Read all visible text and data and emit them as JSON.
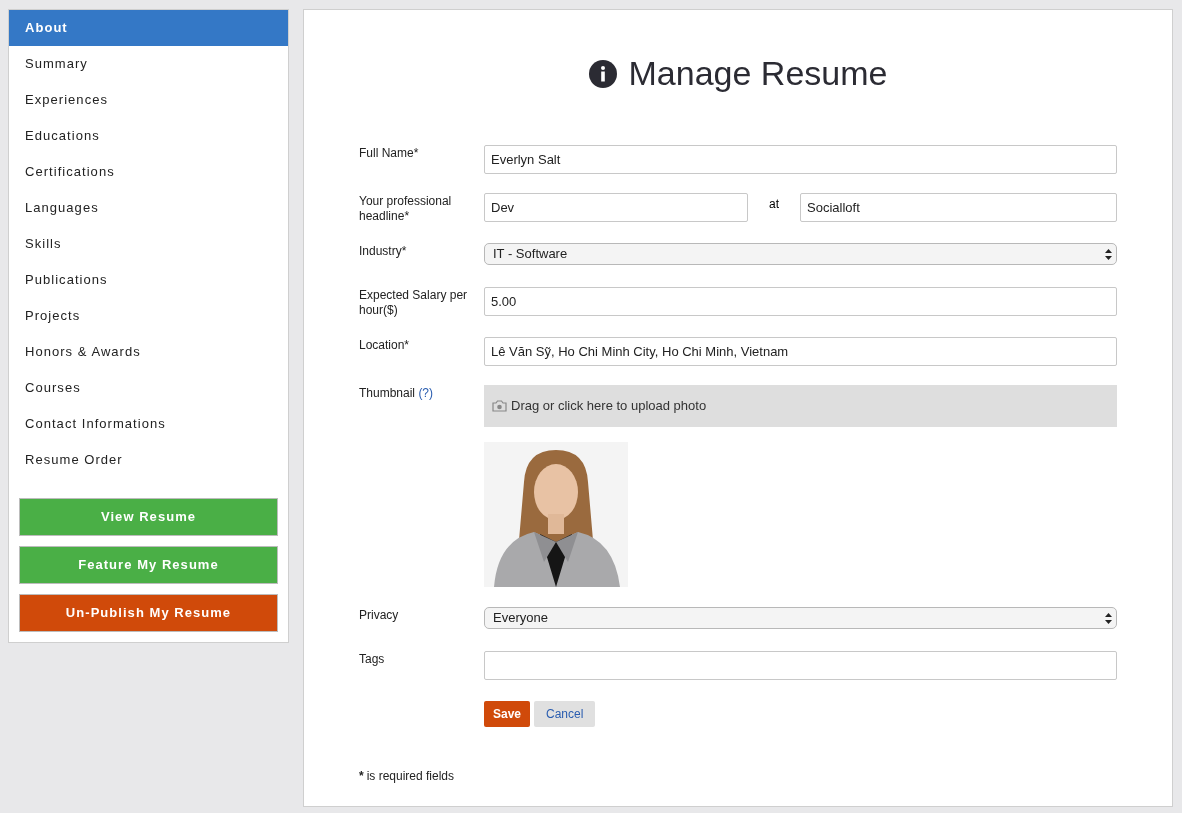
{
  "sidebar": {
    "items": [
      {
        "label": "About",
        "selected": true
      },
      {
        "label": "Summary",
        "selected": false
      },
      {
        "label": "Experiences",
        "selected": false
      },
      {
        "label": "Educations",
        "selected": false
      },
      {
        "label": "Certifications",
        "selected": false
      },
      {
        "label": "Languages",
        "selected": false
      },
      {
        "label": "Skills",
        "selected": false
      },
      {
        "label": "Publications",
        "selected": false
      },
      {
        "label": "Projects",
        "selected": false
      },
      {
        "label": "Honors & Awards",
        "selected": false
      },
      {
        "label": "Courses",
        "selected": false
      },
      {
        "label": "Contact Informations",
        "selected": false
      },
      {
        "label": "Resume Order",
        "selected": false
      }
    ],
    "buttons": [
      {
        "label": "View Resume",
        "color": "#4aaf46"
      },
      {
        "label": "Feature My Resume",
        "color": "#4aaf46"
      },
      {
        "label": "Un-Publish My Resume",
        "color": "#d04a0a"
      }
    ]
  },
  "title": "Manage Resume",
  "fields": [
    {
      "kind": "text",
      "label": "Full Name*",
      "value": "Everlyn Salt"
    },
    {
      "kind": "pair",
      "label": "Your professional headline*",
      "value": "Dev",
      "joiner": "at",
      "value2": "Socialloft"
    },
    {
      "kind": "select",
      "label": "Industry*",
      "value": "IT - Software"
    },
    {
      "kind": "text",
      "label": "Expected Salary per hour($)",
      "value": "5.00"
    },
    {
      "kind": "text",
      "label": "Location*",
      "value": "Lê Văn Sỹ, Ho Chi Minh City, Ho Chi Minh, Vietnam"
    },
    {
      "kind": "upload",
      "label": "Thumbnail",
      "help": "(?)",
      "prompt": "Drag or click here to upload photo"
    },
    {
      "kind": "select",
      "label": "Privacy",
      "value": "Everyone"
    },
    {
      "kind": "text",
      "label": "Tags"
    }
  ],
  "actions": {
    "save": "Save",
    "cancel": "Cancel"
  },
  "note": {
    "mark": "*",
    "text": "is required fields"
  }
}
